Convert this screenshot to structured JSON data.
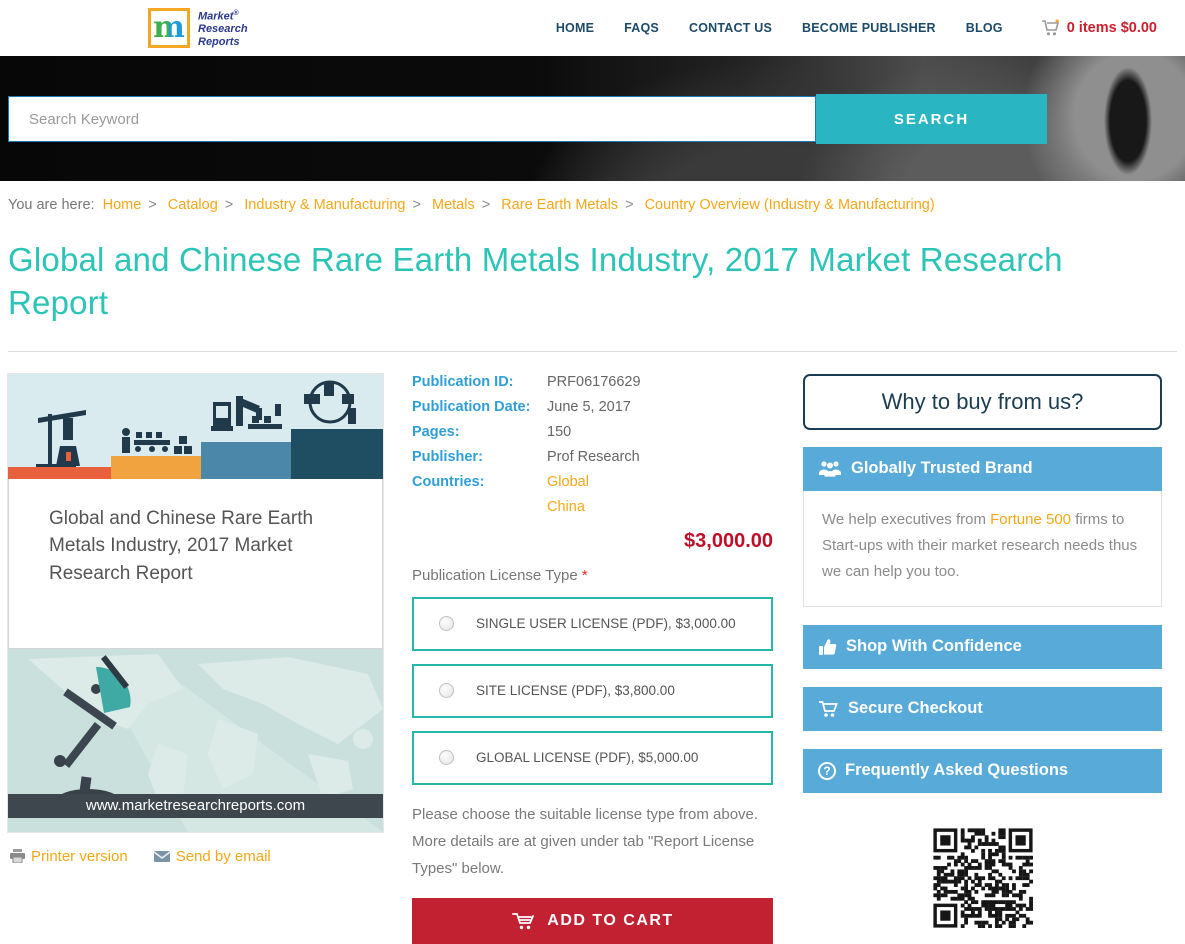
{
  "header": {
    "logo": {
      "letter": "m",
      "line1": "Market",
      "line2": "Research",
      "line3": "Reports",
      "registered": "®"
    },
    "nav": [
      "HOME",
      "FAQS",
      "CONTACT US",
      "BECOME PUBLISHER",
      "BLOG"
    ],
    "cart_text": "0 items $0.00"
  },
  "banner": {
    "search_placeholder": "Search Keyword",
    "search_button": "SEARCH"
  },
  "breadcrumb": {
    "prefix": "You are here:",
    "separator": ">",
    "items": [
      "Home",
      "Catalog",
      "Industry & Manufacturing",
      "Metals",
      "Rare Earth Metals",
      "Country Overview (Industry & Manufacturing)"
    ]
  },
  "page_title": "Global and Chinese Rare Earth Metals Industry, 2017 Market Research Report",
  "product_image": {
    "cover_title": "Global and Chinese Rare Earth Metals Industry, 2017 Market Research Report",
    "website": "www.marketresearchreports.com"
  },
  "actions": {
    "printer": "Printer version",
    "email": "Send by email"
  },
  "details": {
    "rows": [
      {
        "label": "Publication ID:",
        "value": "PRF06176629"
      },
      {
        "label": "Publication Date:",
        "value": "June 5, 2017"
      },
      {
        "label": "Pages:",
        "value": "150"
      },
      {
        "label": "Publisher:",
        "value": "Prof Research"
      },
      {
        "label": "Countries:",
        "value": "Global"
      },
      {
        "label": "",
        "value": "China"
      }
    ],
    "price": "$3,000.00",
    "license_label": "Publication License Type ",
    "required_mark": "*",
    "licenses": [
      "SINGLE USER LICENSE (PDF), $3,000.00",
      "SITE LICENSE (PDF), $3,800.00",
      "GLOBAL LICENSE (PDF), $5,000.00"
    ],
    "note": "Please choose the suitable license type from above. More details are at given under tab \"Report License Types\" below.",
    "add_to_cart": "ADD TO CART"
  },
  "sidebar": {
    "why_box": "Why to buy from us?",
    "trusted_title": "Globally Trusted Brand",
    "trusted_body_pre": "We help executives from ",
    "trusted_body_link": "Fortune 500",
    "trusted_body_post": " firms to Start-ups with their market research needs thus we can help you too.",
    "bar2": "Shop With Confidence",
    "bar3": "Secure Checkout",
    "bar4": "Frequently Asked Questions"
  },
  "colors": {
    "accent_teal": "#2ab5c2",
    "title_teal": "#2bc4b6",
    "link_orange": "#f7a717",
    "label_blue": "#2f9fd6",
    "price_red": "#bf0f28",
    "button_red": "#c12130",
    "sidebar_blue": "#58aad9",
    "navy": "#1c4a68"
  }
}
